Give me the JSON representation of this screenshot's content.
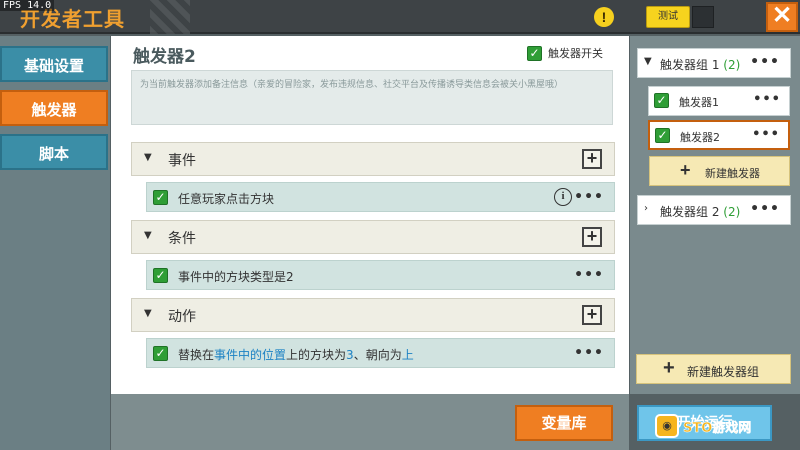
{
  "fps": "FPS 14.0",
  "header": {
    "title": "开发者工具",
    "test_label": "测试",
    "close_label": "✕",
    "warning_label": "!"
  },
  "sidebar": {
    "items": [
      {
        "label": "基础设置"
      },
      {
        "label": "触发器"
      },
      {
        "label": "脚本"
      }
    ]
  },
  "main": {
    "title": "触发器2",
    "switch_label": "触发器开关",
    "description_placeholder": "为当前触发器添加备注信息（亲爱的冒险家，发布违规信息、社交平台及传播诱导类信息会被关小黑屋哦）",
    "sections": [
      {
        "label": "事件"
      },
      {
        "label": "条件"
      },
      {
        "label": "动作"
      }
    ],
    "event_row": "任意玩家点击方块",
    "condition_row": "事件中的方块类型是2",
    "action_row": {
      "p1": "替换在",
      "p2": "事件中的位置",
      "p3": "上的方块为",
      "p4": "3",
      "p5": "、朝向为",
      "p6": "上"
    },
    "more": "•••",
    "info": "i",
    "plus": "+"
  },
  "right": {
    "group1_label": "触发器组 1",
    "group1_count": "(2)",
    "triggers": [
      {
        "label": "触发器1"
      },
      {
        "label": "触发器2"
      }
    ],
    "new_trigger": "新建触发器",
    "group2_label": "触发器组 2",
    "group2_count": "(2)",
    "new_group": "新建触发器组",
    "more": "•••",
    "plus": "+"
  },
  "footer": {
    "var_button": "变量库",
    "run_button": "开始运行",
    "watermark": "STO游戏网"
  },
  "icons": {
    "check": "✓"
  },
  "colors": {
    "accent_orange": "#ef7e22",
    "nav_blue": "#3b8ea7",
    "check_green": "#2f9e36",
    "link_blue": "#1d82c4",
    "warning_yellow": "#f6d01e"
  }
}
